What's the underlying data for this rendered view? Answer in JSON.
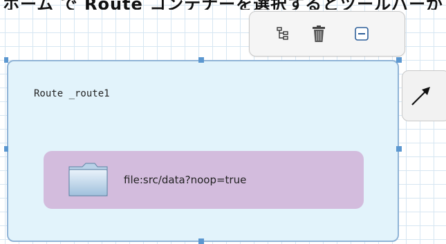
{
  "header_text": "ホーム で Route コンテナーを選択するとツールバーが",
  "toolbar": {
    "tree_icon": "tree-structure-icon",
    "trash_icon": "trash-icon",
    "collapse_icon": "collapse-minus-icon"
  },
  "arrow_icon": "connector-arrow-icon",
  "route": {
    "title": "Route _route1",
    "endpoint": {
      "icon": "folder-icon",
      "label": "file:src/data?noop=true"
    }
  },
  "colors": {
    "route_fill": "#e2f3fb",
    "route_border": "#8fb3d6",
    "endpoint_fill": "#d3bcdd",
    "handle": "#5b97d0"
  }
}
